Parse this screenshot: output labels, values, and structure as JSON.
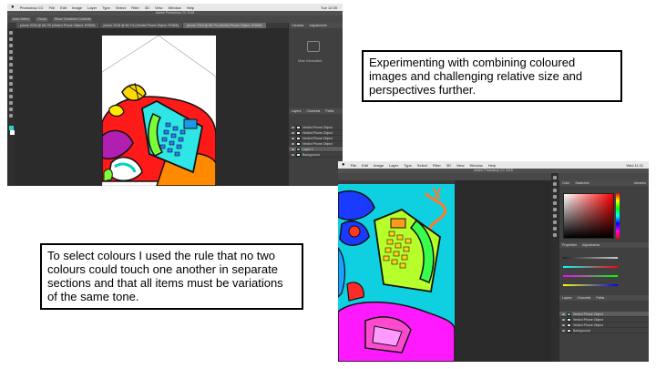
{
  "captions": {
    "top": "Experimenting with combining coloured images and challenging relative size and perspectives further.",
    "bottom": "To select colours I used the rule that no two colours could touch one another in separate sections and that all items must be variations of the same tone."
  },
  "screenshot1": {
    "app_name": "Photoshop CC",
    "menu": [
      "File",
      "Edit",
      "Image",
      "Layer",
      "Type",
      "Select",
      "Filter",
      "3D",
      "View",
      "Window",
      "Help"
    ],
    "clock": "Tue 12:35",
    "window_title": "Adobe Photoshop CC 2018",
    "tabs": [
      "phone 2018 @ 66.7% (Verdict Phone Object, RGB/8)",
      "phone 2018 @ 66.7% (Verdict Phone Object, RGB/8)",
      "phone 2018 @ 66.7% (Verdict Phone Object, RGB/8)"
    ],
    "options": [
      "Auto-Select",
      "Group",
      "Show Transform Controls"
    ],
    "panel_tabs": [
      "Libraries",
      "Adjustments"
    ],
    "libraries_label": "More Information",
    "layers_tabs": [
      "Layers",
      "Channels",
      "Paths"
    ],
    "layers": [
      "Verdict Phone Object",
      "Verdict Phone Object",
      "Verdict Phone Object",
      "Verdict Phone Object",
      "Layer 1",
      "Background"
    ]
  },
  "screenshot2": {
    "menu": [
      "File",
      "Edit",
      "Image",
      "Layer",
      "Type",
      "Select",
      "Filter",
      "3D",
      "View",
      "Window",
      "Help"
    ],
    "clock": "Wed 11:11",
    "window_title": "Adobe Photoshop CC 2018",
    "panel_tabs": [
      "Color",
      "Swatches"
    ],
    "libraries_tab": "Libraries",
    "properties_tabs": [
      "Properties",
      "Adjustments"
    ],
    "layers_tabs": [
      "Layers",
      "Channels",
      "Paths"
    ],
    "layers": [
      "Verdict Phone Object",
      "Verdict Phone Object",
      "Verdict Phone Object",
      "Background"
    ]
  }
}
